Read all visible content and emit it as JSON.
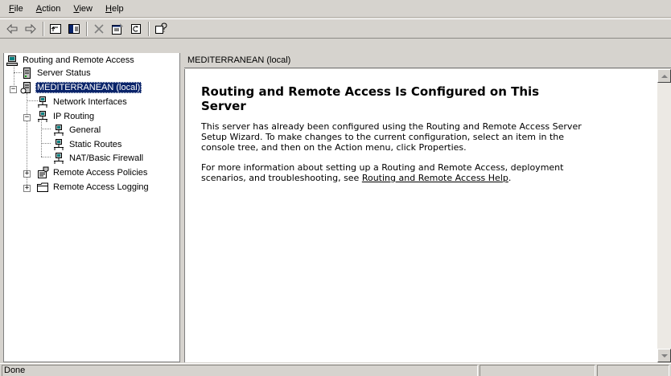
{
  "menubar": {
    "file": {
      "hot": "F",
      "rest": "ile"
    },
    "action": {
      "hot": "A",
      "rest": "ction"
    },
    "view": {
      "hot": "V",
      "rest": "iew"
    },
    "help": {
      "hot": "H",
      "rest": "elp"
    }
  },
  "toolbar": {
    "buttons": [
      "back-icon",
      "forward-icon",
      "up-one-level-icon",
      "show-hide-console-tree-icon",
      "delete-icon",
      "properties-icon",
      "refresh-icon",
      "help-icon"
    ]
  },
  "tree": {
    "root": "Routing and Remote Access",
    "server_status": "Server Status",
    "server": "MEDITERRANEAN (local)",
    "network_interfaces": "Network Interfaces",
    "ip_routing": "IP Routing",
    "general": "General",
    "static_routes": "Static Routes",
    "nat": "NAT/Basic Firewall",
    "policies": "Remote Access Policies",
    "logging": "Remote Access Logging"
  },
  "right": {
    "header": "MEDITERRANEAN (local)",
    "title_line1": "Routing and Remote Access Is Configured on This",
    "title_line2": "Server",
    "para1_line1": "This server has already been configured using the Routing and Remote Access Server",
    "para1_line2": "Setup Wizard. To make changes to the current configuration, select an item in the",
    "para1_line3": "console tree, and then on the Action menu, click Properties.",
    "para2_line1": "For more information about setting up a Routing and Remote Access, deployment",
    "para2_prefix": "scenarios, and troubleshooting, see ",
    "para2_link": "Routing and Remote Access Help",
    "para2_suffix": "."
  },
  "status": {
    "text": "Done"
  },
  "colors": {
    "chrome": "#d6d3ce",
    "selection": "#0a246a",
    "window": "#ffffff"
  }
}
